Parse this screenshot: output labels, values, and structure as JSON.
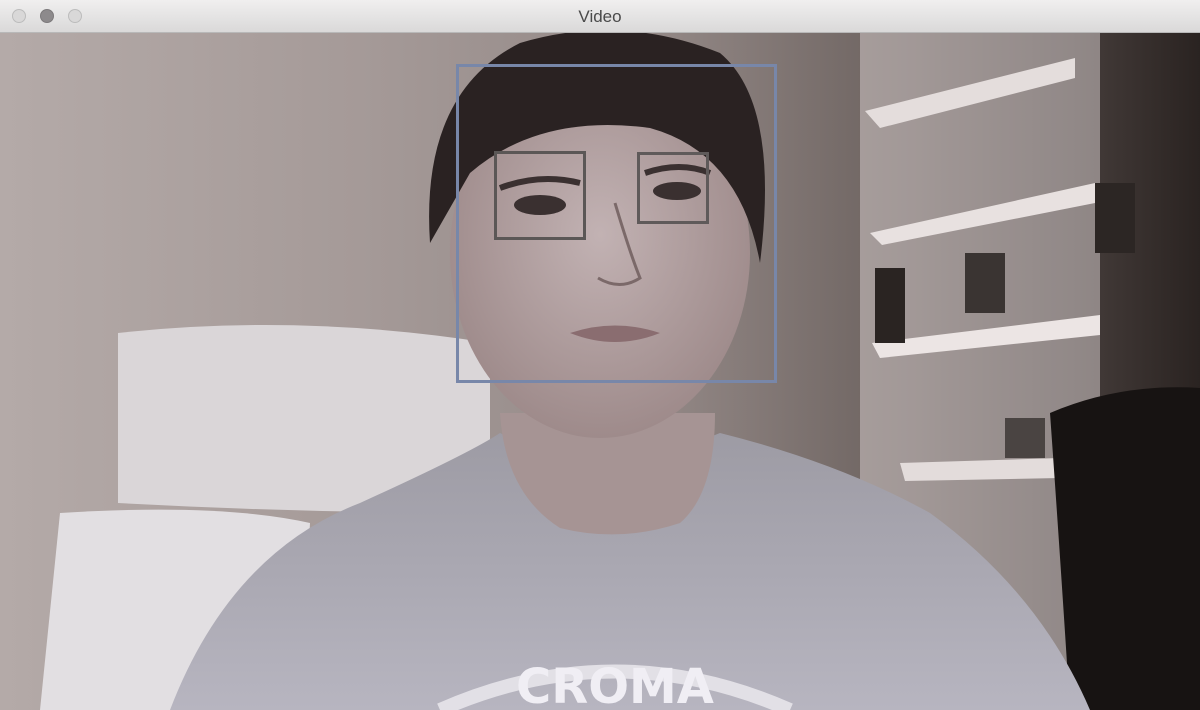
{
  "window": {
    "title": "Video",
    "controls": [
      "close-button",
      "minimize-button",
      "zoom-button"
    ]
  },
  "detections": {
    "face": {
      "label": "face",
      "color": "#7887a9"
    },
    "eyes": [
      {
        "label": "left-eye",
        "color": "#5b5756"
      },
      {
        "label": "right-eye",
        "color": "#5f5a5a"
      }
    ]
  },
  "shirt_text": "CROMA"
}
